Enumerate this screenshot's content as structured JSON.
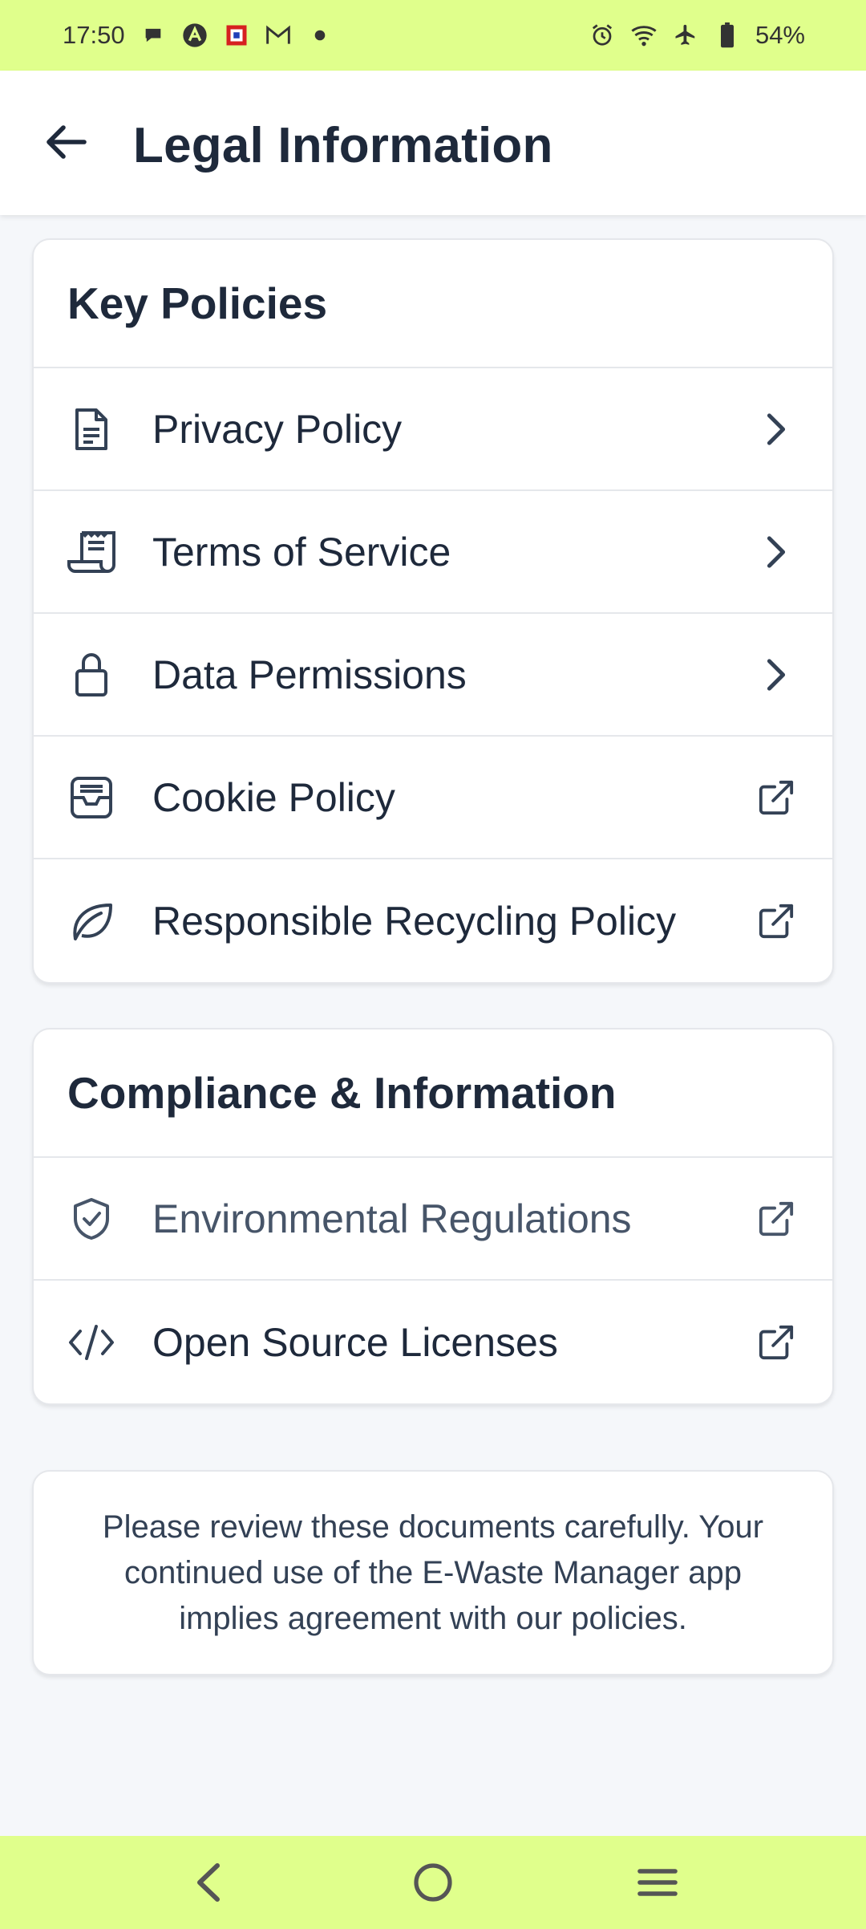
{
  "status_bar": {
    "time": "17:50",
    "battery": "54%",
    "left_icons": [
      "chat-bubble-icon",
      "app-a-icon",
      "app-square-icon",
      "gmail-icon",
      "dot-icon"
    ],
    "right_icons": [
      "alarm-icon",
      "wifi-icon",
      "airplane-icon",
      "battery-icon"
    ],
    "bg_color": "#e0ff8c"
  },
  "header": {
    "title": "Legal Information",
    "back_icon": "arrow-left-icon"
  },
  "key_policies": {
    "title": "Key Policies",
    "items": [
      {
        "label": "Privacy Policy",
        "icon": "document-icon",
        "trail": "chevron-right-icon"
      },
      {
        "label": "Terms of Service",
        "icon": "receipt-icon",
        "trail": "chevron-right-icon"
      },
      {
        "label": "Data Permissions",
        "icon": "lock-icon",
        "trail": "chevron-right-icon"
      },
      {
        "label": "Cookie Policy",
        "icon": "inbox-icon",
        "trail": "external-link-icon"
      },
      {
        "label": "Responsible Recycling Policy",
        "icon": "leaf-icon",
        "trail": "external-link-icon"
      }
    ]
  },
  "compliance": {
    "title": "Compliance & Information",
    "items": [
      {
        "label": "Environmental Regulations",
        "icon": "shield-check-icon",
        "trail": "external-link-icon"
      },
      {
        "label": "Open Source Licenses",
        "icon": "code-icon",
        "trail": "external-link-icon"
      }
    ]
  },
  "note": {
    "text": "Please review these documents carefully. Your continued use of the E-Waste Manager app implies agreement with our policies."
  },
  "nav_bar": {
    "buttons": [
      "back-nav-icon",
      "home-nav-icon",
      "menu-nav-icon"
    ]
  }
}
